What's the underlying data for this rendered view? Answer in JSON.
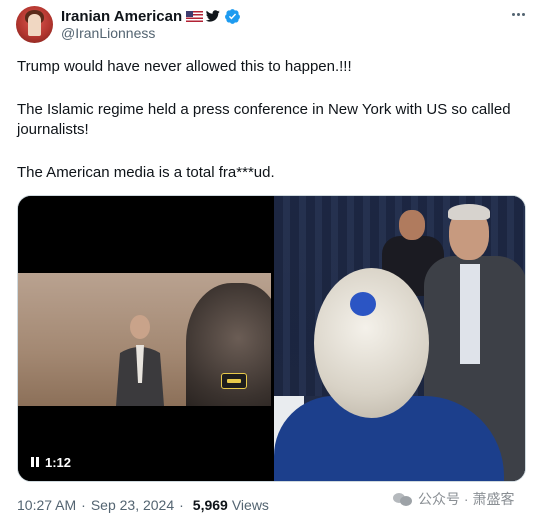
{
  "author": {
    "display_name": "Iranian American",
    "handle": "@IranLionness",
    "badges": [
      "us-flag-icon",
      "twitter-bird-icon",
      "verified-badge-icon"
    ]
  },
  "more_button_icon": "more-horizontal-icon",
  "tweet": {
    "line1": "Trump would have never allowed this to happen.!!!",
    "line2": "The Islamic regime held a press conference in New York with US so called journalists!",
    "line3": "The American media is a total fra***ud."
  },
  "media": {
    "video": {
      "duration": "1:12",
      "state_icon": "pause-icon"
    },
    "photo": {
      "alt_icon": "photo"
    }
  },
  "meta": {
    "time": "10:27 AM",
    "separator": "·",
    "date": "Sep 23, 2024",
    "views_count": "5,969",
    "views_label": "Views"
  },
  "watermark": {
    "text": "公众号 · 萧盛客",
    "icon": "wechat-icon"
  },
  "colors": {
    "text_primary": "#0f1419",
    "text_secondary": "#536471",
    "verified": "#1d9bf0",
    "border": "#cfd9de"
  }
}
